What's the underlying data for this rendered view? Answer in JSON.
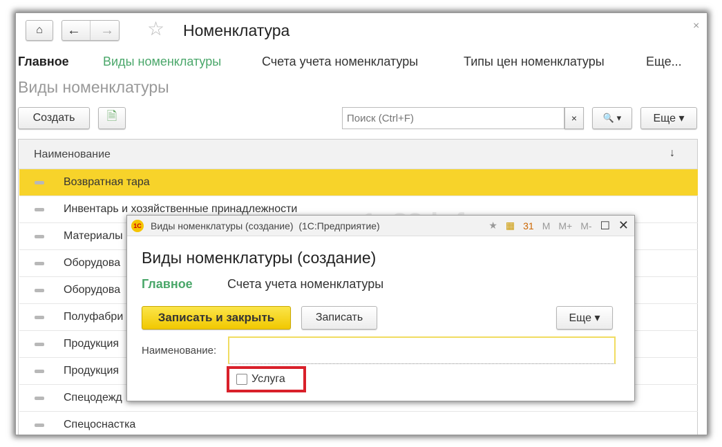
{
  "window": {
    "title": "Номенклатура",
    "close": "×"
  },
  "tabs": [
    "Главное",
    "Виды номенклатуры",
    "Счета учета номенклатуры",
    "Типы цен номенклатуры",
    "Еще..."
  ],
  "section_title": "Виды номенклатуры",
  "toolbar": {
    "create": "Создать",
    "search_placeholder": "Поиск (Ctrl+F)",
    "search_clear": "×",
    "search_btn": "🔍 ▾",
    "more": "Еще ▾"
  },
  "list": {
    "header": "Наименование",
    "sort": "↓",
    "rows": [
      "Возвратная тара",
      "Инвентарь и хозяйственные принадлежности",
      "Материалы",
      "Оборудова",
      "Оборудова",
      "Полуфабри",
      "Продукция",
      "Продукция",
      "Спецодежд",
      "Спецоснастка"
    ]
  },
  "dialog": {
    "title": "Виды номенклатуры (создание)  (1С:Предприятие)",
    "heading": "Виды номенклатуры (создание)",
    "tabs": [
      "Главное",
      "Счета учета номенклатуры"
    ],
    "save_close": "Записать и закрыть",
    "save": "Записать",
    "more": "Еще ▾",
    "name_label": "Наименование:",
    "name_value": "",
    "service_label": "Услуга",
    "service_checked": false,
    "title_icons": [
      "M",
      "M+",
      "M-"
    ]
  },
  "watermark": "1c83.info",
  "colors": {
    "accent_green": "#4aa76a",
    "selection": "#f7d32a",
    "highlight_box": "#d9202a"
  }
}
